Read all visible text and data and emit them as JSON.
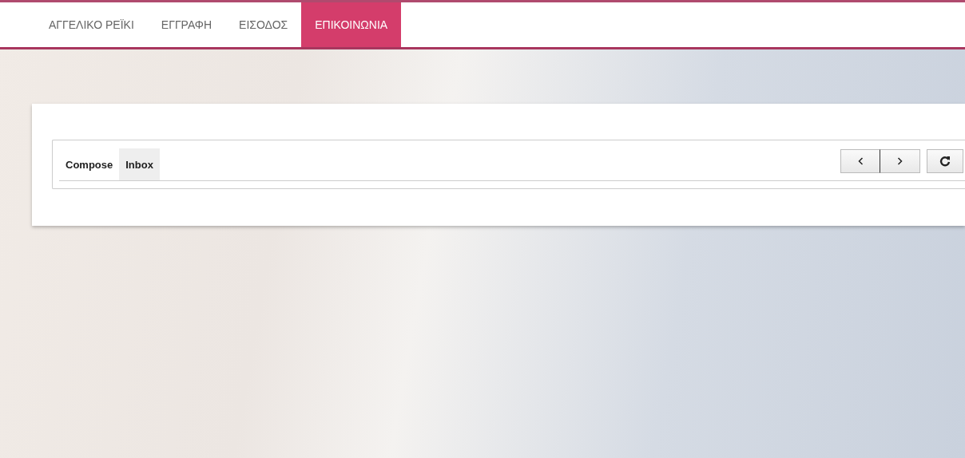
{
  "nav": {
    "items": [
      {
        "label": "ΑΓΓΕΛΙΚΟ ΡΕΪΚΙ",
        "selected": false
      },
      {
        "label": "ΕΓΓΡΑΦΗ",
        "selected": false
      },
      {
        "label": "ΕΙΣΟΔΟΣ",
        "selected": false
      },
      {
        "label": "ΕΠΙΚΟΙΝΩΝΙΑ",
        "selected": true
      }
    ]
  },
  "mail": {
    "tabs": [
      {
        "label": "Compose",
        "selected": false
      },
      {
        "label": "Inbox",
        "selected": true
      }
    ]
  }
}
